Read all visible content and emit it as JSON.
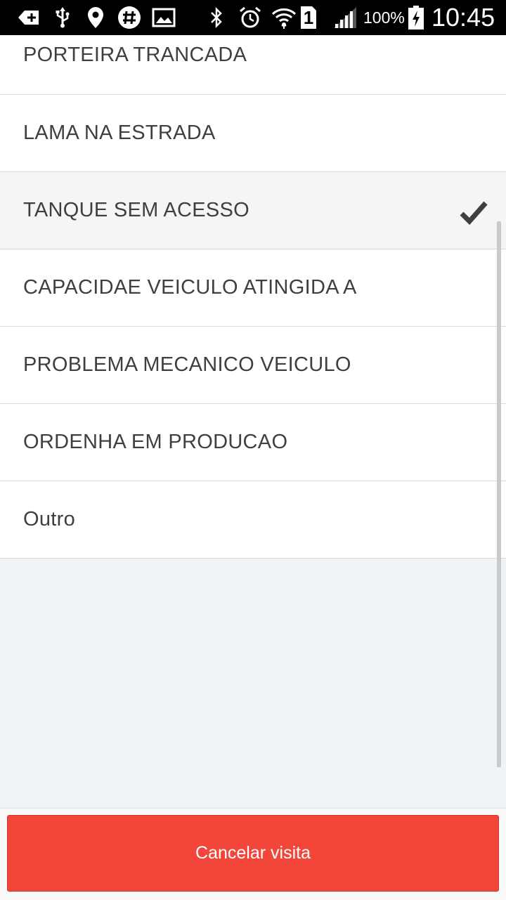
{
  "status_bar": {
    "battery_percent": "100%",
    "time": "10:45",
    "sim_slot": "1",
    "icons": [
      "add-notification-icon",
      "usb-icon",
      "location-icon",
      "slack-icon",
      "image-icon",
      "bluetooth-icon",
      "alarm-icon",
      "wifi-icon",
      "signal-icon",
      "battery-charging-icon"
    ]
  },
  "list": {
    "items": [
      {
        "label": "PORTEIRA TRANCADA",
        "selected": false
      },
      {
        "label": "LAMA NA ESTRADA",
        "selected": false
      },
      {
        "label": "TANQUE SEM ACESSO",
        "selected": true
      },
      {
        "label": "CAPACIDAE VEICULO ATINGIDA A",
        "selected": false
      },
      {
        "label": "PROBLEMA MECANICO VEICULO",
        "selected": false
      },
      {
        "label": "ORDENHA EM PRODUCAO",
        "selected": false
      },
      {
        "label": "Outro",
        "selected": false
      }
    ]
  },
  "footer": {
    "cancel_label": "Cancelar visita"
  },
  "colors": {
    "accent": "#f2463a",
    "selected_row": "#f5f5f5",
    "background": "#eff3f6"
  }
}
